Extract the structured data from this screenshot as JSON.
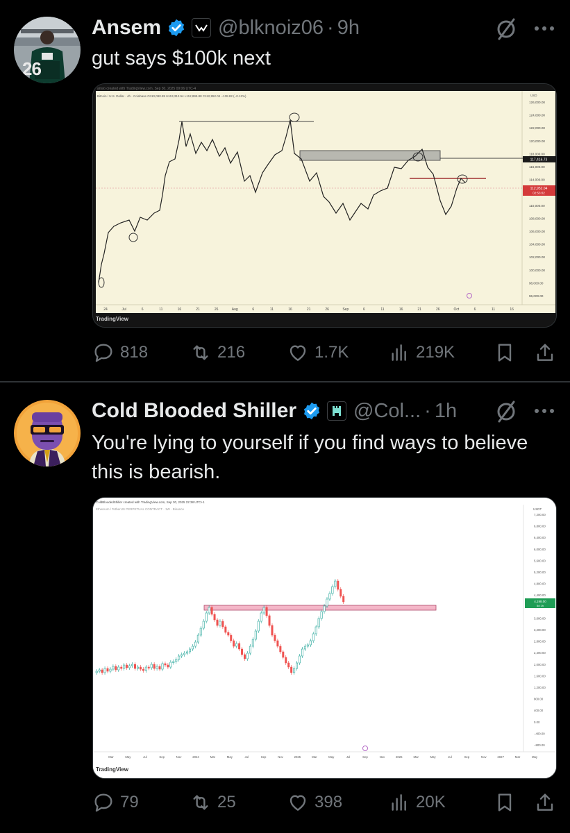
{
  "tweets": [
    {
      "author_name": "Ansem",
      "handle": "@blknoiz06",
      "separator": "·",
      "time": "9h",
      "text": "gut says $100k next",
      "media": {
        "header_line1": "ansio created with TradingView.com, Sep 30, 2025 09:06 UTC-4",
        "header_line2": "Bitcoin / U.S. Dollar · 4h · Coinbase  O110,090.85 H113,312.54 L112,895.88 C112,952.04 −138.82 (−0.12%)",
        "price_axis_unit": "USD",
        "price_ticks": [
          "126,000.00",
          "124,000.00",
          "122,000.00",
          "120,000.00",
          "118,000.00",
          "116,000.00",
          "114,000.00",
          "112,000.00",
          "110,000.00",
          "108,000.00",
          "106,000.00",
          "104,000.00",
          "102,000.00",
          "100,000.00",
          "98,000.00",
          "96,000.00"
        ],
        "price_tag_1": "117,416.73",
        "price_tag_2": "112,952.04",
        "price_tag_2_sub": "02:53:02",
        "time_ticks": [
          "24",
          "Jul",
          "6",
          "11",
          "16",
          "21",
          "26",
          "Aug",
          "6",
          "11",
          "16",
          "21",
          "26",
          "Sep",
          "6",
          "11",
          "16",
          "21",
          "26",
          "Oct",
          "6",
          "11",
          "16"
        ],
        "logo_text": "TradingView"
      },
      "stats": {
        "replies": "818",
        "retweets": "216",
        "likes": "1.7K",
        "views": "219K"
      }
    },
    {
      "author_name": "Cold Blooded Shiller",
      "handle": "@Col...",
      "separator": "·",
      "time": "1h",
      "text": "You're lying to yourself if you find ways to believe this is bearish.",
      "media": {
        "header_line1": "ColdBloodedShiller created with TradingView.com, Sep 30, 2025 22:38 UTC+1",
        "header_line2": "Ethereum / TetherUS PERPETUAL CONTRACT · 1W · Binance",
        "price_axis_unit": "USDT",
        "price_ticks": [
          "7,200.00",
          "6,800.00",
          "6,400.00",
          "6,000.00",
          "5,600.00",
          "5,200.00",
          "4,800.00",
          "4,400.00",
          "4,000.00",
          "3,600.00",
          "3,200.00",
          "2,800.00",
          "2,400.00",
          "2,000.00",
          "1,600.00",
          "1,200.00",
          "800.00",
          "400.00",
          "0.00",
          "−400.00",
          "−800.00"
        ],
        "price_tag_1": "4,198.00",
        "price_tag_1_sub": "5d 1h",
        "time_ticks": [
          "Mar",
          "May",
          "Jul",
          "Sep",
          "Nov",
          "2024",
          "Mar",
          "May",
          "Jul",
          "Sep",
          "Nov",
          "2025",
          "Mar",
          "May",
          "Jul",
          "Sep",
          "Nov",
          "2026",
          "Mar",
          "May",
          "Jul",
          "Sep",
          "Nov",
          "2027",
          "Mar",
          "May"
        ],
        "logo_text": "TradingView"
      },
      "stats": {
        "replies": "79",
        "retweets": "25",
        "likes": "398",
        "views": "20K"
      }
    }
  ],
  "colors": {
    "background": "#000000",
    "text_primary": "#e7e9ea",
    "text_secondary": "#71767b",
    "verified_blue": "#1d9bf0",
    "divider": "#2f3336",
    "chart1_bg": "#f7f3dc",
    "chart2_green": "#26a69a",
    "chart2_red": "#ef5350"
  },
  "icons": {
    "verified": "verified-badge-icon",
    "grok": "grok-icon",
    "more": "more-dots-icon",
    "reply": "reply-bubble-icon",
    "retweet": "retweet-arrows-icon",
    "like": "heart-icon",
    "views": "bar-chart-icon",
    "bookmark": "bookmark-icon",
    "share": "share-upload-icon"
  }
}
